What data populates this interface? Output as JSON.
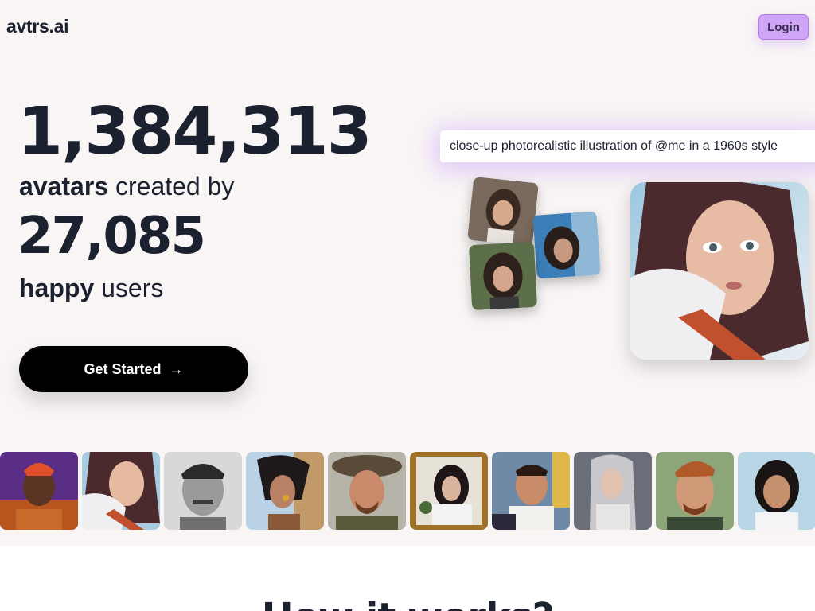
{
  "header": {
    "logo": "avtrs.ai",
    "login_label": "Login"
  },
  "hero": {
    "avatars_count": "1,384,313",
    "avatars_bold": "avatars",
    "avatars_rest": " created by",
    "users_count": "27,085",
    "users_bold": "happy",
    "users_rest": " users",
    "cta_label": "Get Started",
    "cta_arrow": "→"
  },
  "demo": {
    "prompt_text": "close-up photorealistic illustration of @me in a 1960s style"
  },
  "section": {
    "title": "How it works?"
  },
  "colors": {
    "accent": "#cfa6f7",
    "text": "#1c2130",
    "background": "#f9f5f5"
  }
}
